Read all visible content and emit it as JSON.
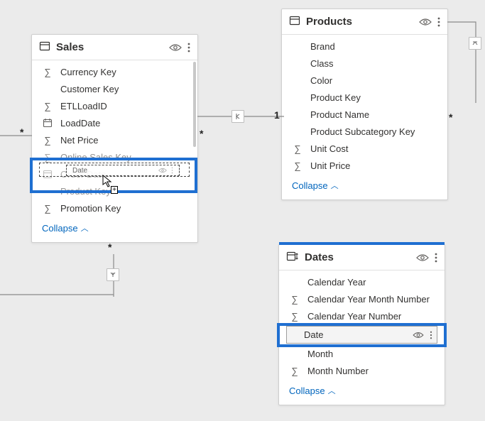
{
  "tables": {
    "sales": {
      "title": "Sales",
      "fields": [
        {
          "icon": "sigma",
          "label": "Currency Key"
        },
        {
          "icon": "",
          "label": "Customer Key"
        },
        {
          "icon": "sigma",
          "label": "ETLLoadID"
        },
        {
          "icon": "cal",
          "label": "LoadDate"
        },
        {
          "icon": "sigma",
          "label": "Net Price"
        },
        {
          "icon": "sigma",
          "label": "Online Sales Key"
        },
        {
          "icon": "cal",
          "label": "Order Date"
        },
        {
          "icon": "",
          "label": "Product Key"
        },
        {
          "icon": "sigma",
          "label": "Promotion Key"
        }
      ],
      "collapse": "Collapse"
    },
    "products": {
      "title": "Products",
      "fields": [
        {
          "icon": "",
          "label": "Brand"
        },
        {
          "icon": "",
          "label": "Class"
        },
        {
          "icon": "",
          "label": "Color"
        },
        {
          "icon": "",
          "label": "Product Key"
        },
        {
          "icon": "",
          "label": "Product Name"
        },
        {
          "icon": "",
          "label": "Product Subcategory Key"
        },
        {
          "icon": "sigma",
          "label": "Unit Cost"
        },
        {
          "icon": "sigma",
          "label": "Unit Price"
        }
      ],
      "collapse": "Collapse"
    },
    "dates": {
      "title": "Dates",
      "fields": [
        {
          "icon": "",
          "label": "Calendar Year"
        },
        {
          "icon": "sigma",
          "label": "Calendar Year Month Number"
        },
        {
          "icon": "sigma",
          "label": "Calendar Year Number"
        },
        {
          "icon": "sel",
          "label": "Date"
        },
        {
          "icon": "",
          "label": "Month"
        },
        {
          "icon": "sigma",
          "label": "Month Number"
        }
      ],
      "collapse": "Collapse"
    }
  },
  "drag_ghost": {
    "label": "Date"
  },
  "multiplicity": {
    "sales_products_left": "*",
    "sales_products_right": "1",
    "sales_left_edge": "*",
    "sales_bottom": "*",
    "products_right": "*"
  }
}
